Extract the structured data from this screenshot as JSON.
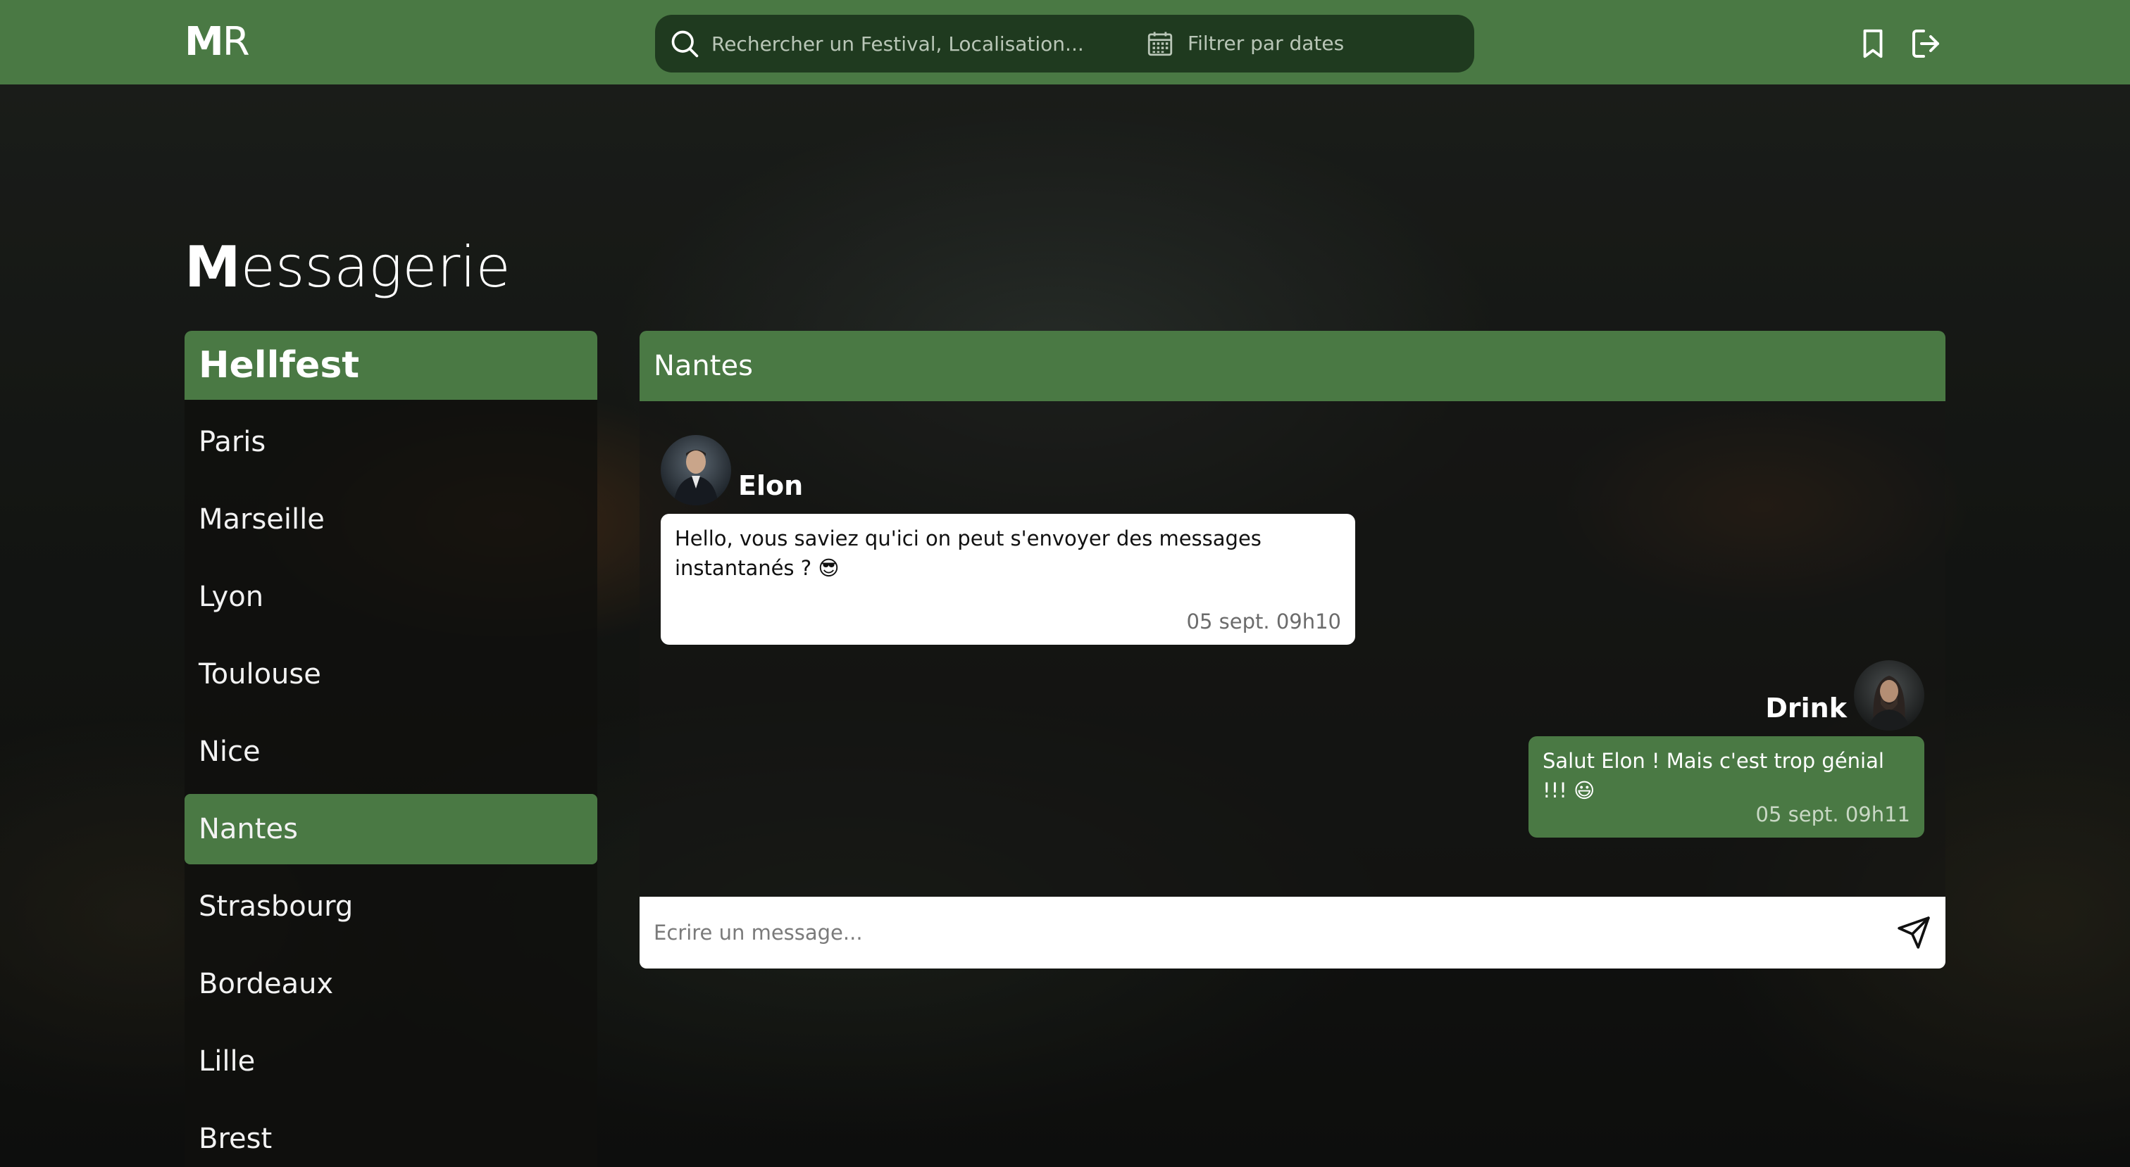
{
  "logo": {
    "bold": "M",
    "light": "R"
  },
  "search": {
    "placeholder": "Rechercher un Festival, Localisation...",
    "date_filter": "Filtrer par dates"
  },
  "page": {
    "title_first": "M",
    "title_rest": "essagerie"
  },
  "sidebar": {
    "festival": "Hellfest",
    "items": [
      {
        "label": "Paris",
        "active": false
      },
      {
        "label": "Marseille",
        "active": false
      },
      {
        "label": "Lyon",
        "active": false
      },
      {
        "label": "Toulouse",
        "active": false
      },
      {
        "label": "Nice",
        "active": false
      },
      {
        "label": "Nantes",
        "active": true
      },
      {
        "label": "Strasbourg",
        "active": false
      },
      {
        "label": "Bordeaux",
        "active": false
      },
      {
        "label": "Lille",
        "active": false
      },
      {
        "label": "Brest",
        "active": false
      }
    ]
  },
  "chat": {
    "room": "Nantes",
    "messages": [
      {
        "sender": "Elon",
        "text_line1": "Hello, vous saviez qu'ici on peut s'envoyer des messages",
        "text_line2": "instantanés ? 😎",
        "time": "05 sept. 09h10",
        "direction": "incoming"
      },
      {
        "sender": "Drink",
        "text": "Salut Elon ! Mais c'est trop génial !!! 😃",
        "time": "05 sept. 09h11",
        "direction": "outgoing"
      }
    ],
    "composer_placeholder": "Ecrire un message..."
  },
  "colors": {
    "brand_green": "#4a7944",
    "search_bg": "#1f3a1f"
  },
  "icons": [
    "search-icon",
    "calendar-icon",
    "bookmark-icon",
    "logout-icon",
    "send-icon"
  ]
}
